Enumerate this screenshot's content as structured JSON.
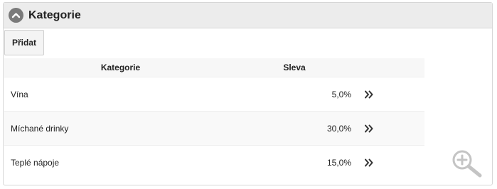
{
  "panel": {
    "title": "Kategorie",
    "add_label": "Přidat"
  },
  "table": {
    "headers": {
      "category": "Kategorie",
      "discount": "Sleva"
    },
    "rows": [
      {
        "name": "Vína",
        "discount": "5,0%"
      },
      {
        "name": "Míchané drinky",
        "discount": "30,0%"
      },
      {
        "name": "Teplé nápoje",
        "discount": "15,0%"
      }
    ]
  },
  "icons": {
    "collapse": "chevron-up-circle-icon",
    "row_action": "double-chevron-right-icon",
    "zoom": "zoom-in-icon"
  },
  "colors": {
    "header_bg": "#ececec",
    "icon_gray": "#7a7a7a"
  }
}
